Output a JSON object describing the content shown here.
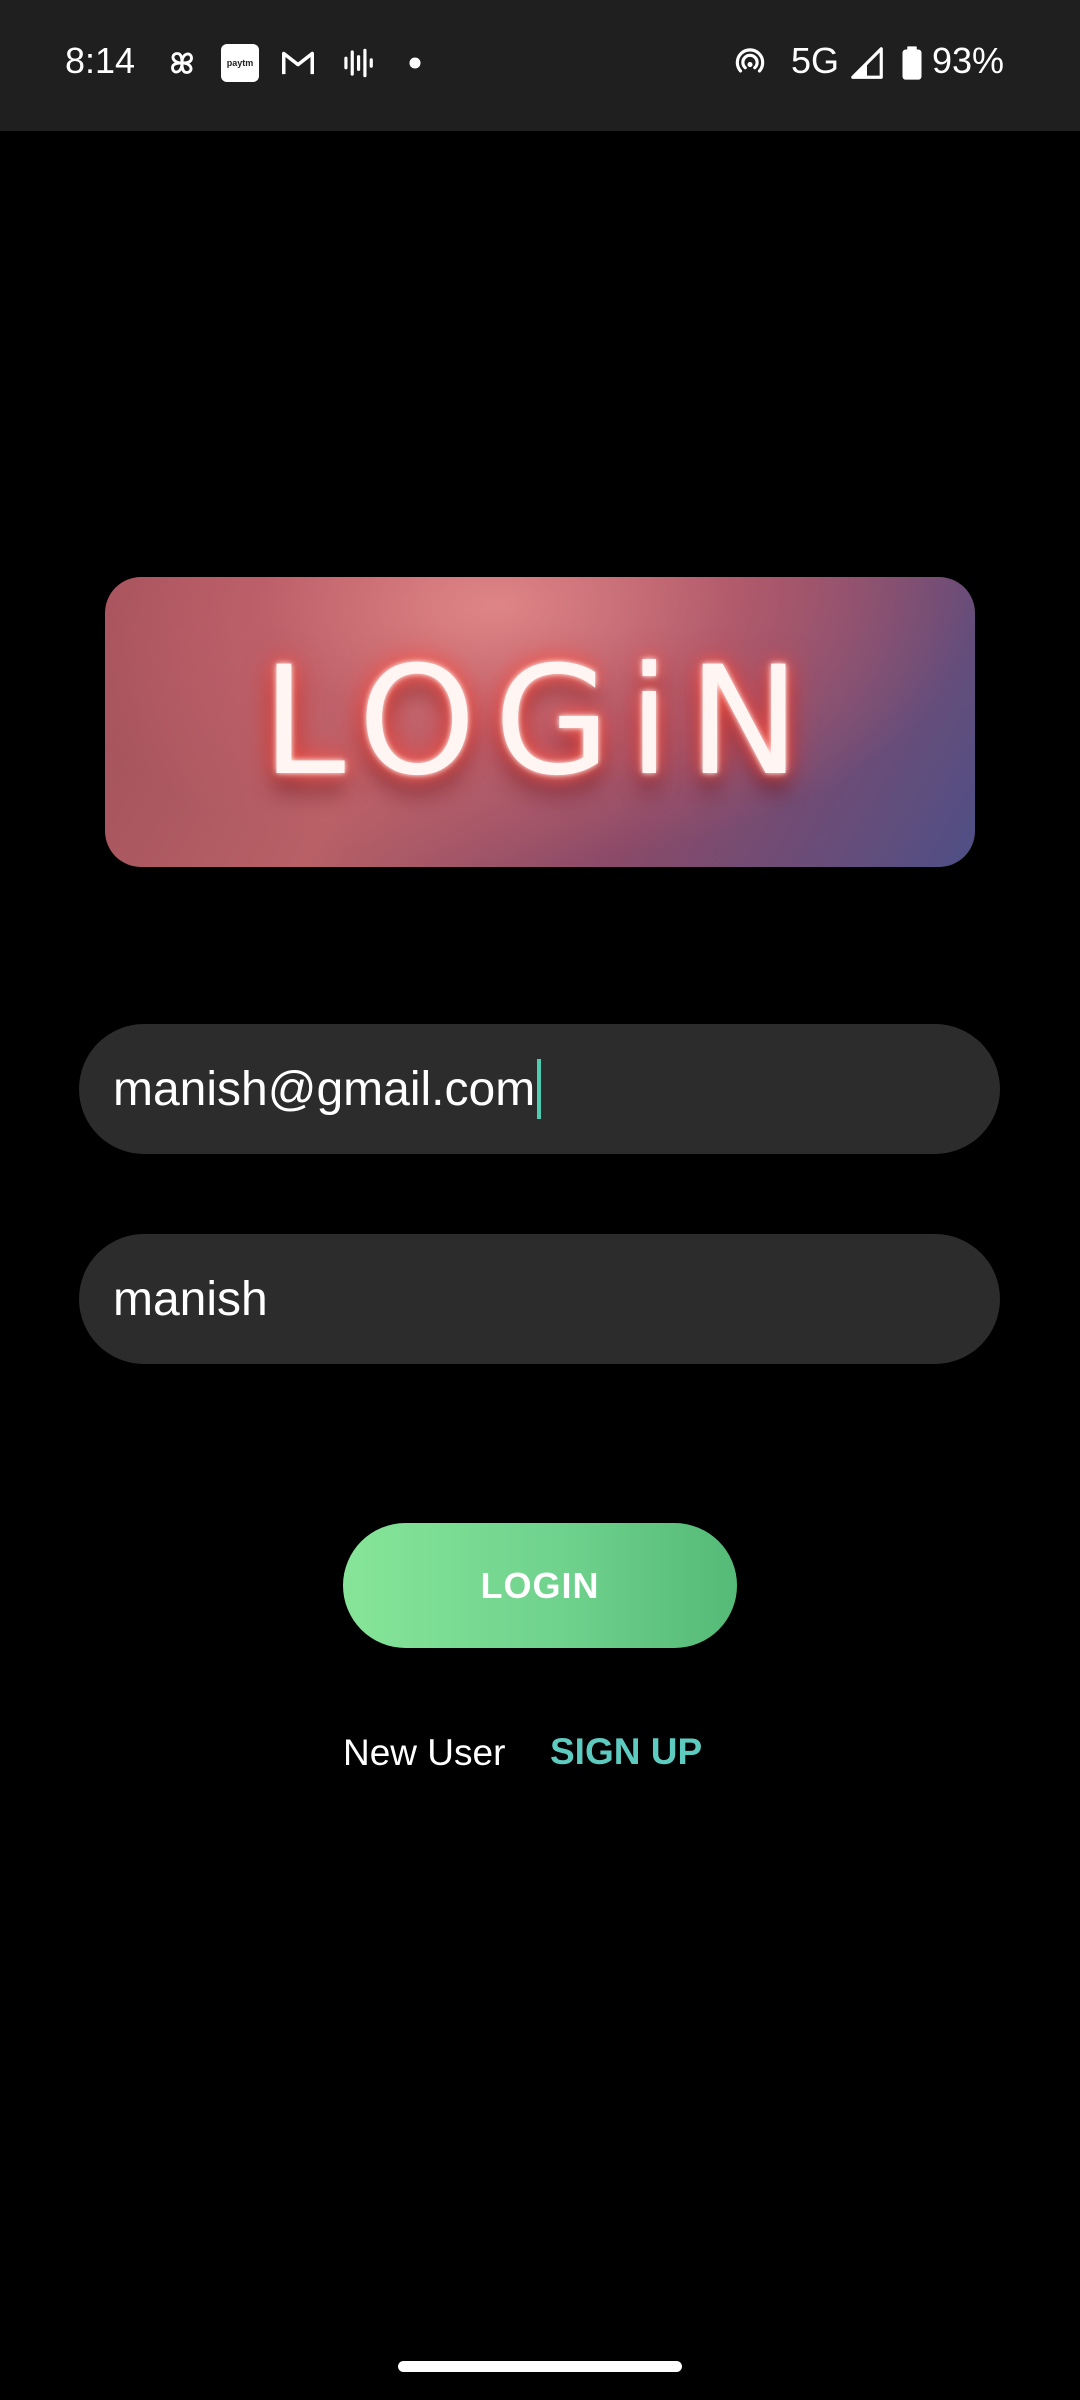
{
  "status_bar": {
    "time": "8:14",
    "network": "5G",
    "battery": "93%",
    "icons": [
      "pinwheel-icon",
      "paytm-icon",
      "gmail-icon",
      "voice-icon",
      "dot-icon",
      "hotspot-icon",
      "signal-icon",
      "battery-icon"
    ],
    "paytm_label": "paytm"
  },
  "hero": {
    "title": "LOGiN"
  },
  "form": {
    "email_value": "manish@gmail.com",
    "password_value": "manish",
    "login_label": "LOGIN",
    "new_user_text": "New User",
    "signup_label": "SIGN UP"
  },
  "colors": {
    "background": "#000000",
    "field": "#2c2c2c",
    "button_gradient_start": "#86e598",
    "button_gradient_end": "#55ba77",
    "signup": "#5ecbc0"
  }
}
